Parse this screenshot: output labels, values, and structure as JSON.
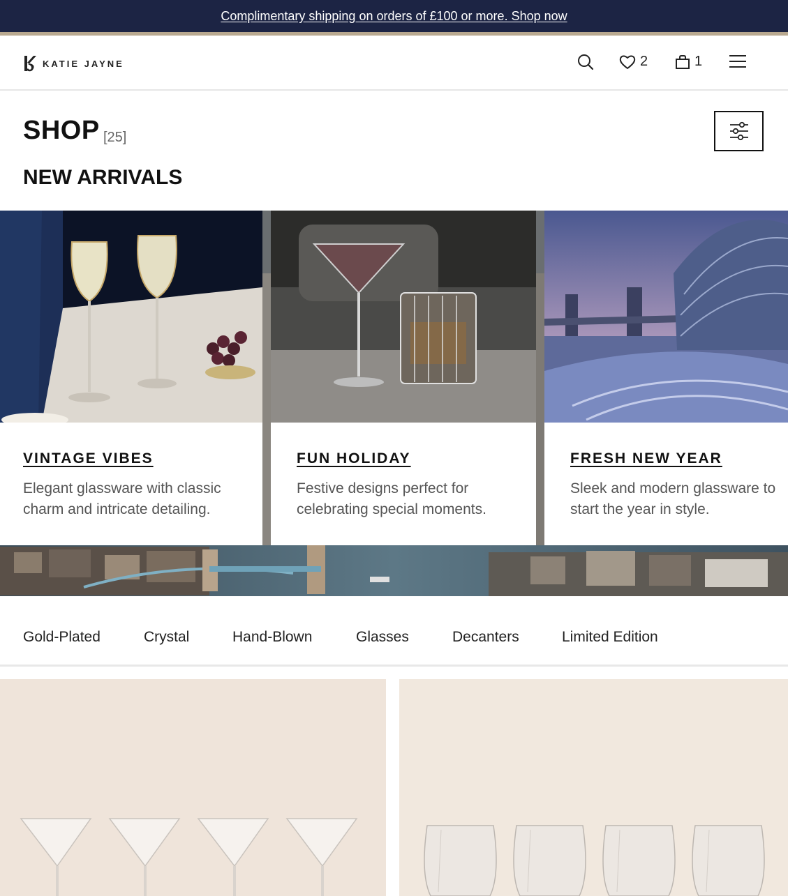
{
  "promo": {
    "text": "Complimentary shipping on orders of £100 or more. Shop now"
  },
  "header": {
    "brand": "KATIE JAYNE",
    "icons": [
      "search-icon",
      "heart-icon",
      "bag-icon",
      "menu-icon"
    ],
    "wishlist_count": "2",
    "cart_count": "1"
  },
  "shop": {
    "title": "SHOP",
    "count": "[25]",
    "section": "NEW ARRIVALS"
  },
  "collections": [
    {
      "title": "VINTAGE VIBES",
      "description": "Elegant glassware with classic charm and intricate detailing."
    },
    {
      "title": "FUN HOLIDAY",
      "description": "Festive designs perfect for celebrating special moments."
    },
    {
      "title": "FRESH NEW YEAR",
      "description": "Sleek and modern glassware to start the year in style."
    }
  ],
  "categories": [
    "Gold-Plated",
    "Crystal",
    "Hand-Blown",
    "Glasses",
    "Decanters",
    "Limited Edition"
  ],
  "colors": {
    "promo_bg": "#1c2444",
    "promo_rule": "#b9a990",
    "text": "#1a1a1a",
    "muted": "#555555"
  }
}
